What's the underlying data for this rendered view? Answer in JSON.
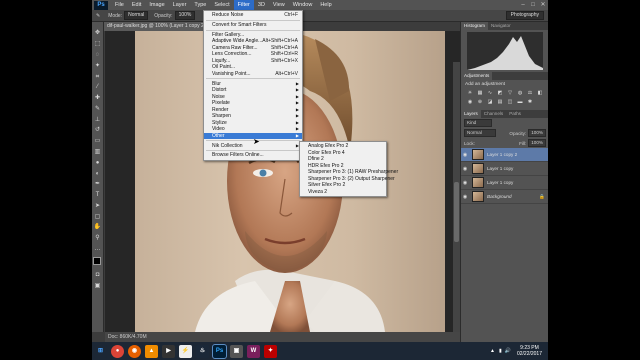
{
  "menubar": {
    "logo": "Ps",
    "items": [
      "File",
      "Edit",
      "Image",
      "Layer",
      "Type",
      "Select",
      "Filter",
      "3D",
      "View",
      "Window",
      "Help"
    ],
    "active_index": 6
  },
  "options_bar": {
    "mode_label": "Mode:",
    "mode_value": "Normal",
    "opacity_label": "Opacity:",
    "opacity_value": "100%",
    "workspace": "Photography"
  },
  "document": {
    "tab": "dif-paul-walker.jpg @ 100% (Layer 1 copy 2, RGB/8) *",
    "status": "Doc: 860K/4.70M"
  },
  "filter_menu": {
    "items": [
      {
        "label": "Reduce Noise",
        "shortcut": "Ctrl+F"
      },
      {
        "sep": true
      },
      {
        "label": "Convert for Smart Filters"
      },
      {
        "sep": true
      },
      {
        "label": "Filter Gallery..."
      },
      {
        "label": "Adaptive Wide Angle...",
        "shortcut": "Alt+Shift+Ctrl+A"
      },
      {
        "label": "Camera Raw Filter...",
        "shortcut": "Shift+Ctrl+A"
      },
      {
        "label": "Lens Correction...",
        "shortcut": "Shift+Ctrl+R"
      },
      {
        "label": "Liquify...",
        "shortcut": "Shift+Ctrl+X"
      },
      {
        "label": "Oil Paint..."
      },
      {
        "label": "Vanishing Point...",
        "shortcut": "Alt+Ctrl+V"
      },
      {
        "sep": true
      },
      {
        "label": "Blur",
        "sub": true
      },
      {
        "label": "Distort",
        "sub": true
      },
      {
        "label": "Noise",
        "sub": true
      },
      {
        "label": "Pixelate",
        "sub": true
      },
      {
        "label": "Render",
        "sub": true
      },
      {
        "label": "Sharpen",
        "sub": true
      },
      {
        "label": "Stylize",
        "sub": true
      },
      {
        "label": "Video",
        "sub": true
      },
      {
        "label": "Other",
        "sub": true,
        "highlight": true
      },
      {
        "sep": true
      },
      {
        "label": "Nik Collection",
        "sub": true
      },
      {
        "sep": true
      },
      {
        "label": "Browse Filters Online..."
      }
    ]
  },
  "nik_submenu": {
    "items": [
      "Analog Efex Pro 2",
      "Color Efex Pro 4",
      "Dfine 2",
      "HDR Efex Pro 2",
      "Sharpener Pro 3: (1) RAW Presharpener",
      "Sharpener Pro 3: (2) Output Sharpener",
      "Silver Efex Pro 2",
      "Viveza 2"
    ]
  },
  "panels": {
    "histogram_tabs": [
      "Histogram",
      "Navigator"
    ],
    "adjustments_tab": "Adjustments",
    "adjustments_hint": "Add an adjustment",
    "layer_tabs": [
      "Layers",
      "Channels",
      "Paths"
    ],
    "blend_mode": "Normal",
    "opacity_label": "Opacity:",
    "opacity_value": "100%",
    "lock_label": "Lock:",
    "fill_label": "Fill:",
    "fill_value": "100%",
    "kind_label": "Kind",
    "layers": [
      {
        "name": "Layer 1 copy 2",
        "selected": true
      },
      {
        "name": "Layer 1 copy",
        "selected": false
      },
      {
        "name": "Layer 1 copy",
        "selected": false
      },
      {
        "name": "Background",
        "selected": false
      }
    ]
  },
  "taskbar": {
    "apps": [
      "start",
      "chrome",
      "firefox",
      "vlc",
      "media",
      "winamp",
      "steam",
      "photoshop",
      "app",
      "winrar",
      "game"
    ],
    "time": "9:23 PM",
    "date": "02/22/2017"
  },
  "colors": {
    "menu_highlight": "#3a7bd5",
    "layer_selected": "#5d7aa8",
    "ps_blue": "#49a6ff"
  }
}
